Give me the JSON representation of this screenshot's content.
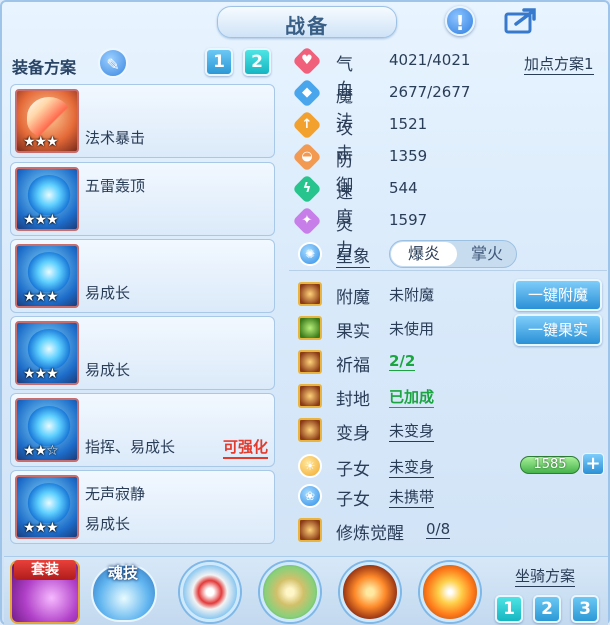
{
  "header": {
    "title": "战备",
    "help_label": "!",
    "share_icon": "share-icon"
  },
  "left": {
    "equip_plan_label": "装备方案",
    "plan_buttons": [
      "1",
      "2"
    ],
    "active_plan": "2",
    "equipment": [
      {
        "line1": "",
        "line2": "法术暴击",
        "stars": "★★★",
        "icon": "ice-pop-weapon-icon",
        "extra": ""
      },
      {
        "line1": "五雷轰顶",
        "line2": "",
        "stars": "★★★",
        "icon": "crystal-helmet-icon",
        "extra": ""
      },
      {
        "line1": "",
        "line2": "易成长",
        "stars": "★★★",
        "icon": "crystal-necklace-icon",
        "extra": ""
      },
      {
        "line1": "",
        "line2": "易成长",
        "stars": "★★★",
        "icon": "crystal-armor-icon",
        "extra": ""
      },
      {
        "line1": "",
        "line2": "指挥、易成长",
        "stars": "★★☆",
        "icon": "crystal-belt-icon",
        "extra": "可强化"
      },
      {
        "line1": "无声寂静",
        "line2": "易成长",
        "stars": "★★★",
        "icon": "crystal-boots-icon",
        "extra": ""
      }
    ]
  },
  "stats": {
    "add_point_plan": "加点方案1",
    "items": [
      {
        "name": "气血",
        "value": "4021/4021",
        "color": "#f0607a",
        "glyph": "♥",
        "icon": "hp-icon"
      },
      {
        "name": "魔法",
        "value": "2677/2677",
        "color": "#4aa6ec",
        "glyph": "◆",
        "icon": "mp-icon"
      },
      {
        "name": "攻击",
        "value": "1521",
        "color": "#f3a12e",
        "glyph": "↑",
        "icon": "attack-icon"
      },
      {
        "name": "防御",
        "value": "1359",
        "color": "#f39a52",
        "glyph": "◒",
        "icon": "defense-icon"
      },
      {
        "name": "速度",
        "value": "544",
        "color": "#27c48e",
        "glyph": "ϟ",
        "icon": "speed-icon"
      },
      {
        "name": "灵力",
        "value": "1597",
        "color": "#c87ee8",
        "glyph": "✦",
        "icon": "spirit-icon"
      }
    ],
    "star_label": "星象",
    "star_options": [
      "爆炎",
      "掌火"
    ],
    "star_selected": "爆炎"
  },
  "attrs": [
    {
      "name": "附魔",
      "value": "未附魔",
      "style": "",
      "icon": "enchant-icon"
    },
    {
      "name": "果实",
      "value": "未使用",
      "style": "",
      "icon": "fruit-icon"
    },
    {
      "name": "祈福",
      "value": "2/2",
      "style": "green",
      "icon": "blessing-icon"
    },
    {
      "name": "封地",
      "value": "已加成",
      "style": "green",
      "icon": "fief-icon"
    },
    {
      "name": "变身",
      "value": "未变身",
      "style": "ul",
      "icon": "transform-icon"
    },
    {
      "name": "子女",
      "value": "未变身",
      "style": "ul",
      "icon": "child-transform-icon"
    },
    {
      "name": "子女",
      "value": "未携带",
      "style": "ul",
      "icon": "child-paw-icon"
    },
    {
      "name": "修炼觉醒",
      "value": "0/8",
      "style": "ul",
      "icon": "cultivation-icon"
    }
  ],
  "buttons": {
    "enchant_all": "一键附魔",
    "fruit_all": "一键果实",
    "child_value": "1585",
    "plus": "+"
  },
  "bottom": {
    "suit_label": "套装",
    "soul_label": "魂技",
    "skill_icons": [
      "red-swirl-skill-icon",
      "golden-warrior-skill-icon",
      "flame-crescent-skill-icon",
      "fire-orb-skill-icon"
    ],
    "mount_label": "坐骑方案",
    "mount_buttons": [
      "1",
      "2",
      "3"
    ]
  }
}
